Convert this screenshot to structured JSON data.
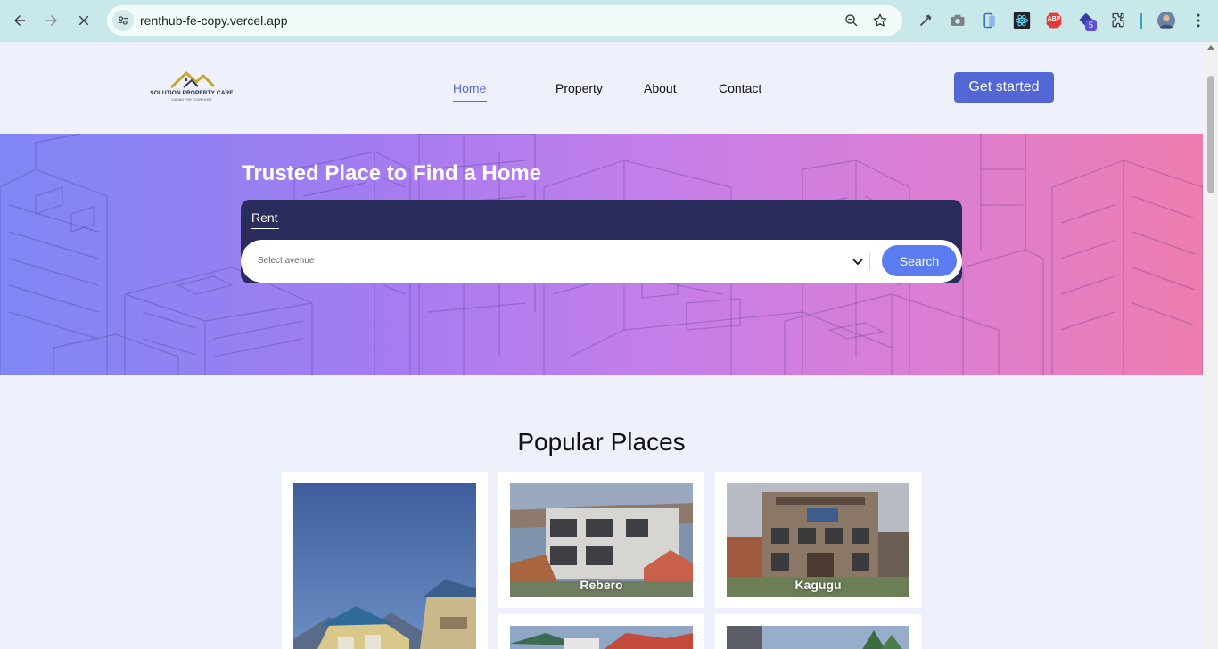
{
  "browser": {
    "url": "renthub-fe-copy.vercel.app",
    "extensions": [
      "eyedropper-icon",
      "camera-icon",
      "phone-mirror-icon",
      "react-devtools-icon",
      "adblock-plus-icon",
      "badge-extension-icon",
      "puzzle-icon"
    ],
    "extension_badge": "5",
    "abp_label": "ABP"
  },
  "header": {
    "logo_name": "SOLUTION PROPERTY CARE",
    "logo_tagline": "CARING FOR YOUR HOME",
    "nav": [
      {
        "label": "Home",
        "active": true
      },
      {
        "label": "Property",
        "active": false
      },
      {
        "label": "About",
        "active": false
      },
      {
        "label": "Contact",
        "active": false
      }
    ],
    "cta_label": "Get started"
  },
  "hero": {
    "title": "Trusted Place to Find a Home",
    "tab_label": "Rent",
    "select_placeholder": "Select avenue",
    "search_label": "Search"
  },
  "popular": {
    "title": "Popular Places",
    "places": [
      {
        "label": ""
      },
      {
        "label": "Rebero"
      },
      {
        "label": "Kagugu"
      },
      {
        "label": ""
      },
      {
        "label": ""
      }
    ]
  },
  "colors": {
    "accent": "#5266d6",
    "search_button": "#5a7cf0",
    "panel": "#2a2d5c",
    "browser_bar": "#c8e8ea"
  }
}
